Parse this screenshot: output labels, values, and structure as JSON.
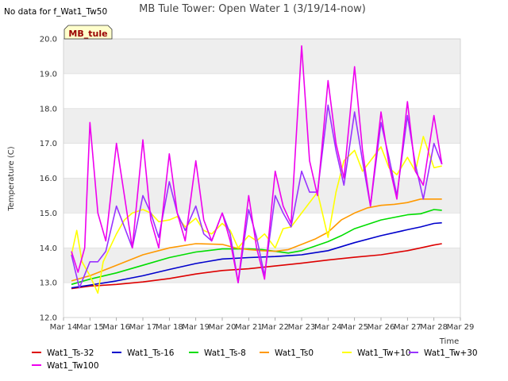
{
  "chart_data": {
    "type": "line",
    "title": "MB Tule Tower: Open Water 1 (3/19/14-now)",
    "corner_note": "No data for f_Wat1_Tw50",
    "badge": "MB_tule",
    "xlabel": "Time",
    "ylabel": "Temperature (C)",
    "xlim": [
      14,
      29
    ],
    "ylim": [
      12.0,
      20.0
    ],
    "x_ticks": [
      14,
      15,
      16,
      17,
      18,
      19,
      20,
      21,
      22,
      23,
      24,
      25,
      26,
      27,
      28,
      29
    ],
    "x_tick_labels": [
      "Mar 14",
      "Mar 15",
      "Mar 16",
      "Mar 17",
      "Mar 18",
      "Mar 19",
      "Mar 20",
      "Mar 21",
      "Mar 22",
      "Mar 23",
      "Mar 24",
      "Mar 25",
      "Mar 26",
      "Mar 27",
      "Mar 28",
      "Mar 29"
    ],
    "y_ticks": [
      12.0,
      13.0,
      14.0,
      15.0,
      16.0,
      17.0,
      18.0,
      19.0,
      20.0
    ],
    "y_tick_labels": [
      "12.0",
      "13.0",
      "14.0",
      "15.0",
      "16.0",
      "17.0",
      "18.0",
      "19.0",
      "20.0"
    ],
    "grid": true,
    "legend_placement": "bottom",
    "series": [
      {
        "name": "Wat1_Ts-32",
        "color": "#dd0000",
        "x": [
          14.3,
          15.0,
          16.0,
          17.0,
          18.0,
          19.0,
          20.0,
          21.0,
          22.0,
          23.0,
          24.0,
          25.0,
          26.0,
          27.0,
          27.5,
          28.0,
          28.3
        ],
        "y": [
          12.83,
          12.9,
          12.95,
          13.02,
          13.12,
          13.25,
          13.35,
          13.4,
          13.48,
          13.56,
          13.65,
          13.73,
          13.8,
          13.92,
          14.0,
          14.08,
          14.12
        ]
      },
      {
        "name": "Wat1_Ts-16",
        "color": "#0000cc",
        "x": [
          14.3,
          15.0,
          16.0,
          17.0,
          18.0,
          19.0,
          20.0,
          21.0,
          22.0,
          23.0,
          24.0,
          25.0,
          26.0,
          27.0,
          27.5,
          28.0,
          28.3
        ],
        "y": [
          12.85,
          12.93,
          13.05,
          13.2,
          13.38,
          13.55,
          13.68,
          13.72,
          13.75,
          13.8,
          13.92,
          14.15,
          14.35,
          14.52,
          14.6,
          14.7,
          14.72
        ]
      },
      {
        "name": "Wat1_Ts-8",
        "color": "#00dd00",
        "x": [
          14.3,
          15.0,
          16.0,
          17.0,
          18.0,
          19.0,
          20.0,
          21.0,
          21.5,
          22.0,
          22.5,
          23.0,
          23.5,
          24.0,
          24.5,
          25.0,
          26.0,
          27.0,
          27.5,
          28.0,
          28.3
        ],
        "y": [
          12.95,
          13.1,
          13.28,
          13.5,
          13.72,
          13.88,
          13.97,
          13.97,
          13.95,
          13.9,
          13.85,
          13.92,
          14.05,
          14.18,
          14.35,
          14.55,
          14.8,
          14.95,
          14.98,
          15.1,
          15.08
        ]
      },
      {
        "name": "Wat1_Ts0",
        "color": "#ff9900",
        "x": [
          14.3,
          15.0,
          16.0,
          17.0,
          18.0,
          19.0,
          20.0,
          20.5,
          21.0,
          21.5,
          22.0,
          22.5,
          23.0,
          23.5,
          24.0,
          24.5,
          25.0,
          25.5,
          26.0,
          26.5,
          27.0,
          27.5,
          28.0,
          28.3
        ],
        "y": [
          13.05,
          13.2,
          13.5,
          13.8,
          14.0,
          14.12,
          14.1,
          14.0,
          13.95,
          13.92,
          13.9,
          13.95,
          14.1,
          14.25,
          14.45,
          14.8,
          15.0,
          15.15,
          15.22,
          15.25,
          15.3,
          15.4,
          15.4,
          15.4
        ]
      },
      {
        "name": "Wat1_Tw+10",
        "color": "#ffff00",
        "x": [
          14.3,
          14.5,
          14.7,
          15.0,
          15.3,
          15.5,
          16.0,
          16.3,
          16.6,
          17.0,
          17.3,
          17.6,
          18.0,
          18.3,
          18.6,
          19.0,
          19.3,
          19.6,
          20.0,
          20.3,
          20.6,
          21.0,
          21.3,
          21.6,
          22.0,
          22.3,
          22.6,
          23.0,
          23.3,
          23.6,
          24.0,
          24.3,
          24.6,
          25.0,
          25.3,
          25.6,
          26.0,
          26.3,
          26.6,
          27.0,
          27.3,
          27.6,
          28.0,
          28.3
        ],
        "y": [
          13.8,
          14.5,
          13.6,
          13.2,
          12.7,
          13.6,
          14.4,
          14.8,
          15.0,
          15.1,
          15.0,
          14.75,
          14.8,
          14.9,
          14.6,
          14.85,
          14.5,
          14.4,
          14.7,
          14.5,
          14.0,
          14.35,
          14.2,
          14.4,
          14.0,
          14.55,
          14.6,
          15.0,
          15.3,
          15.6,
          14.3,
          15.6,
          16.5,
          16.8,
          16.2,
          16.5,
          16.9,
          16.3,
          16.1,
          16.6,
          16.2,
          17.2,
          16.3,
          16.35
        ]
      },
      {
        "name": "Wat1_Tw+30",
        "color": "#9933ff",
        "x": [
          14.3,
          14.6,
          15.0,
          15.3,
          15.6,
          16.0,
          16.3,
          16.6,
          17.0,
          17.3,
          17.6,
          18.0,
          18.3,
          18.6,
          19.0,
          19.3,
          19.6,
          20.0,
          20.3,
          20.6,
          21.0,
          21.3,
          21.6,
          22.0,
          22.3,
          22.6,
          23.0,
          23.3,
          23.6,
          24.0,
          24.3,
          24.6,
          25.0,
          25.3,
          25.6,
          26.0,
          26.3,
          26.6,
          27.0,
          27.3,
          27.6,
          28.0,
          28.3
        ],
        "y": [
          13.8,
          12.85,
          13.6,
          13.6,
          13.9,
          15.2,
          14.6,
          14.0,
          15.5,
          15.0,
          14.3,
          15.9,
          15.0,
          14.5,
          15.2,
          14.4,
          14.2,
          15.0,
          14.4,
          13.0,
          15.1,
          14.3,
          13.2,
          15.5,
          15.0,
          14.6,
          16.2,
          15.6,
          15.6,
          18.1,
          16.8,
          15.8,
          17.9,
          16.5,
          15.2,
          17.6,
          16.6,
          15.5,
          17.8,
          16.4,
          15.4,
          17.0,
          16.4
        ]
      },
      {
        "name": "Wat1_Tw100",
        "color": "#ee00ee",
        "x": [
          14.3,
          14.55,
          14.8,
          15.0,
          15.3,
          15.6,
          16.0,
          16.3,
          16.6,
          17.0,
          17.3,
          17.6,
          18.0,
          18.3,
          18.6,
          19.0,
          19.3,
          19.6,
          20.0,
          20.3,
          20.6,
          21.0,
          21.3,
          21.6,
          22.0,
          22.3,
          22.6,
          23.0,
          23.3,
          23.6,
          24.0,
          24.3,
          24.6,
          25.0,
          25.3,
          25.6,
          26.0,
          26.3,
          26.6,
          27.0,
          27.3,
          27.6,
          28.0,
          28.3
        ],
        "y": [
          13.9,
          13.3,
          14.0,
          17.6,
          15.0,
          14.2,
          17.0,
          15.5,
          14.0,
          17.1,
          14.8,
          14.0,
          16.7,
          15.0,
          14.2,
          16.5,
          14.8,
          14.2,
          15.0,
          14.2,
          13.0,
          15.5,
          14.0,
          13.1,
          16.2,
          15.2,
          14.7,
          19.8,
          16.5,
          15.5,
          18.8,
          17.0,
          16.0,
          19.2,
          16.8,
          15.2,
          17.9,
          16.4,
          15.4,
          18.2,
          16.2,
          15.8,
          17.8,
          16.4
        ]
      }
    ]
  }
}
